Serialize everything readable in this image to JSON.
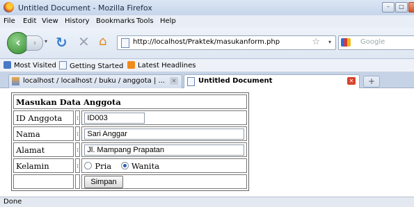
{
  "window": {
    "title": "Untitled Document - Mozilla Firefox",
    "min_label": "–",
    "max_label": "□"
  },
  "menu": [
    "File",
    "Edit",
    "View",
    "History",
    "Bookmarks",
    "Tools",
    "Help"
  ],
  "navigation": {
    "url": "http://localhost/Praktek/masukanform.php",
    "search_placeholder": "Google"
  },
  "bookmarks_bar": [
    "Most Visited",
    "Getting Started",
    "Latest Headlines"
  ],
  "tabs": [
    {
      "label": "localhost / localhost / buku / anggota | ...",
      "active": false
    },
    {
      "label": "Untitled Document",
      "active": true
    }
  ],
  "newtab_symbol": "+",
  "form": {
    "heading": "Masukan Data Anggota",
    "separator": ":",
    "fields": [
      {
        "label": "ID Anggota",
        "value": "ID003"
      },
      {
        "label": "Nama",
        "value": "Sari Anggar"
      },
      {
        "label": "Alamat",
        "value": "Jl. Mampang Prapatan"
      }
    ],
    "gender": {
      "label": "Kelamin",
      "options": [
        "Pria",
        "Wanita"
      ],
      "selected": "Wanita"
    },
    "submit_label": "Simpan"
  },
  "status": "Done",
  "colors": {
    "active_tab_close": "#d9412b",
    "rss": "#f08a1c",
    "back_button": "#3c9a38"
  }
}
